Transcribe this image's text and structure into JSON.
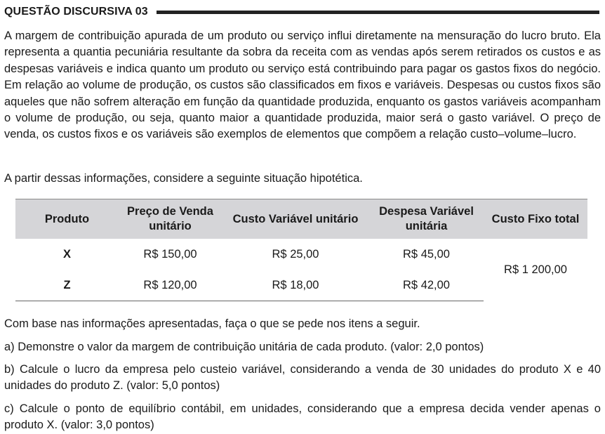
{
  "header": {
    "title": "QUESTÃO DISCURSIVA 03"
  },
  "intro_paragraph": "A margem de contribuição apurada de um produto ou serviço influi diretamente na mensuração do lucro bruto. Ela representa a quantia pecuniária resultante da sobra da receita com as vendas após serem retirados os custos e as despesas variáveis e indica quanto um produto ou serviço está contribuindo para pagar os gastos fixos do negócio. Em relação ao volume de produção, os custos são classificados em fixos e variáveis. Despesas ou custos fixos são aqueles que não sofrem alteração em função da quantidade produzida, enquanto os gastos variáveis acompanham o volume de produção, ou seja, quanto maior a quantidade produzida, maior será o gasto variável. O preço de venda, os custos fixos e os variáveis são exemplos de elementos que compõem a relação custo–volume–lucro.",
  "lead_in": "A partir dessas informações, considere a seguinte situação hipotética.",
  "table": {
    "headers": [
      "Produto",
      "Preço de Venda unitário",
      "Custo Variável unitário",
      "Despesa Variável unitária",
      "Custo Fixo total"
    ],
    "rows": [
      {
        "product": "X",
        "price": "R$ 150,00",
        "variable_cost": "R$ 25,00",
        "variable_expense": "R$ 45,00"
      },
      {
        "product": "Z",
        "price": "R$ 120,00",
        "variable_cost": "R$ 18,00",
        "variable_expense": "R$ 42,00"
      }
    ],
    "fixed_cost_total": "R$ 1 200,00"
  },
  "instruction": "Com base nas informações apresentadas, faça o que se pede nos itens a seguir.",
  "items": {
    "a": "a) Demonstre o valor da margem de contribuição unitária de cada produto. (valor: 2,0 pontos)",
    "b": "b) Calcule o lucro da empresa pelo custeio variável, considerando a venda de 30 unidades do produto X e 40 unidades do produto Z. (valor: 5,0 pontos)",
    "c": "c) Calcule o ponto de equilíbrio contábil, em unidades, considerando que a empresa decida vender apenas o produto X. (valor: 3,0 pontos)"
  }
}
